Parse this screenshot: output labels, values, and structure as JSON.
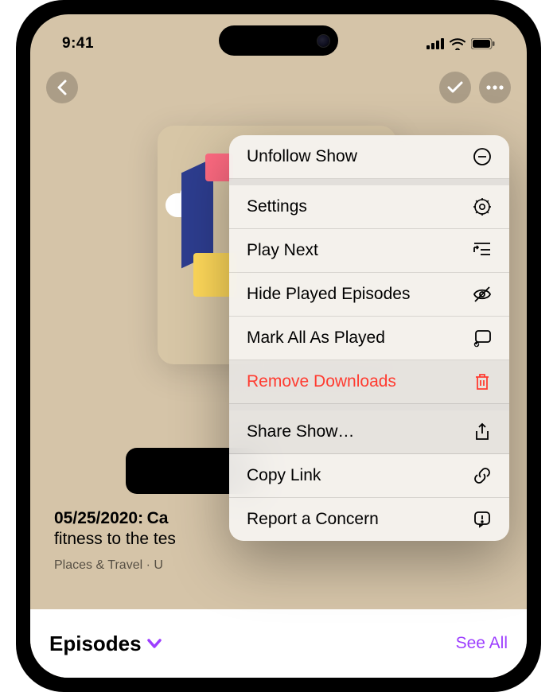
{
  "status": {
    "time": "9:41"
  },
  "episode": {
    "date": "05/25/2020:",
    "title_visible": "Ca",
    "subtitle_visible": "fitness to the tes",
    "category_visible": "Places & Travel · U"
  },
  "menu": {
    "items": [
      {
        "label": "Unfollow Show",
        "icon": "unfollow-icon"
      },
      {
        "label": "Settings",
        "icon": "gear-icon"
      },
      {
        "label": "Play Next",
        "icon": "play-next-icon"
      },
      {
        "label": "Hide Played Episodes",
        "icon": "eye-slash-icon"
      },
      {
        "label": "Mark All As Played",
        "icon": "checkmark-rect-icon"
      },
      {
        "label": "Remove Downloads",
        "icon": "trash-icon",
        "destructive": true,
        "highlighted": true
      },
      {
        "label": "Share Show…",
        "icon": "share-icon",
        "highlighted": true
      },
      {
        "label": "Copy Link",
        "icon": "link-icon"
      },
      {
        "label": "Report a Concern",
        "icon": "report-icon"
      }
    ]
  },
  "bottom": {
    "episodes": "Episodes",
    "see_all": "See All"
  },
  "colors": {
    "accent": "#9d3fff",
    "destructive": "#ff3b30",
    "screen_bg": "#d5c4a8"
  }
}
